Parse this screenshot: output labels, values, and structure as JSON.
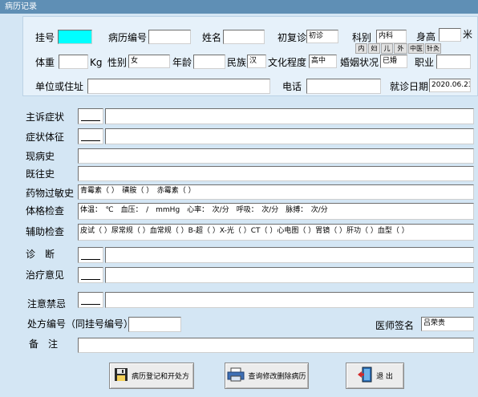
{
  "window": {
    "title": "病历记录"
  },
  "header": {
    "reg_no_label": "挂号",
    "record_no_label": "病历编号",
    "name_label": "姓名",
    "visit_type_label": "初复诊",
    "visit_type_value": "初诊",
    "dept_label": "科别",
    "dept_value": "内科",
    "height_label": "身高",
    "height_unit": "米",
    "weight_label": "体重",
    "weight_unit": "Kg",
    "sex_label": "性别",
    "sex_value": "女",
    "age_label": "年龄",
    "ethnicity_label": "民族",
    "ethnicity_value": "汉",
    "education_label": "文化程度",
    "education_value": "高中",
    "marital_label": "婚姻状况",
    "marital_value": "已婚",
    "occupation_label": "职业",
    "dept_options": [
      "内",
      "妇",
      "儿",
      "外",
      "中医",
      "针灸"
    ],
    "address_label": "单位或住址",
    "phone_label": "电话",
    "visit_date_label": "就诊日期",
    "visit_date_value": "2020.06.23"
  },
  "record": {
    "chief_complaint_label": "主诉症状",
    "symptoms_label": "症状体征",
    "present_history_label": "现病史",
    "past_history_label": "既往史",
    "allergy_label": "药物过敏史",
    "allergy_value": "青霉素（ ）　磺胺（ ）　赤霉素（ ）",
    "physical_exam_label": "体格检查",
    "physical_exam_value": "体温：　℃　血压：　/　mmHg　心率：　次/分　呼吸：　次/分　脉搏：　次/分",
    "aux_exam_label": "辅助检查",
    "aux_exam_value": "皮试（ ）尿常规（ ）血常规（ ）B-超（ ）X-光（ ）CT（ ）心电图（ ）胃镜（ ）肝功（ ）血型（ ）",
    "diagnosis_label": "诊　断",
    "treatment_label": "治疗意见",
    "precautions_label": "注意禁忌",
    "prescription_no_label": "处方编号（同挂号编号）",
    "doctor_sign_label": "医师签名",
    "doctor_sign_value": "吕荣贵",
    "remarks_label": "备　注"
  },
  "buttons": {
    "save_label": "病历登记和开处方",
    "query_label": "查询修改删除病历",
    "exit_label": "退 出"
  }
}
